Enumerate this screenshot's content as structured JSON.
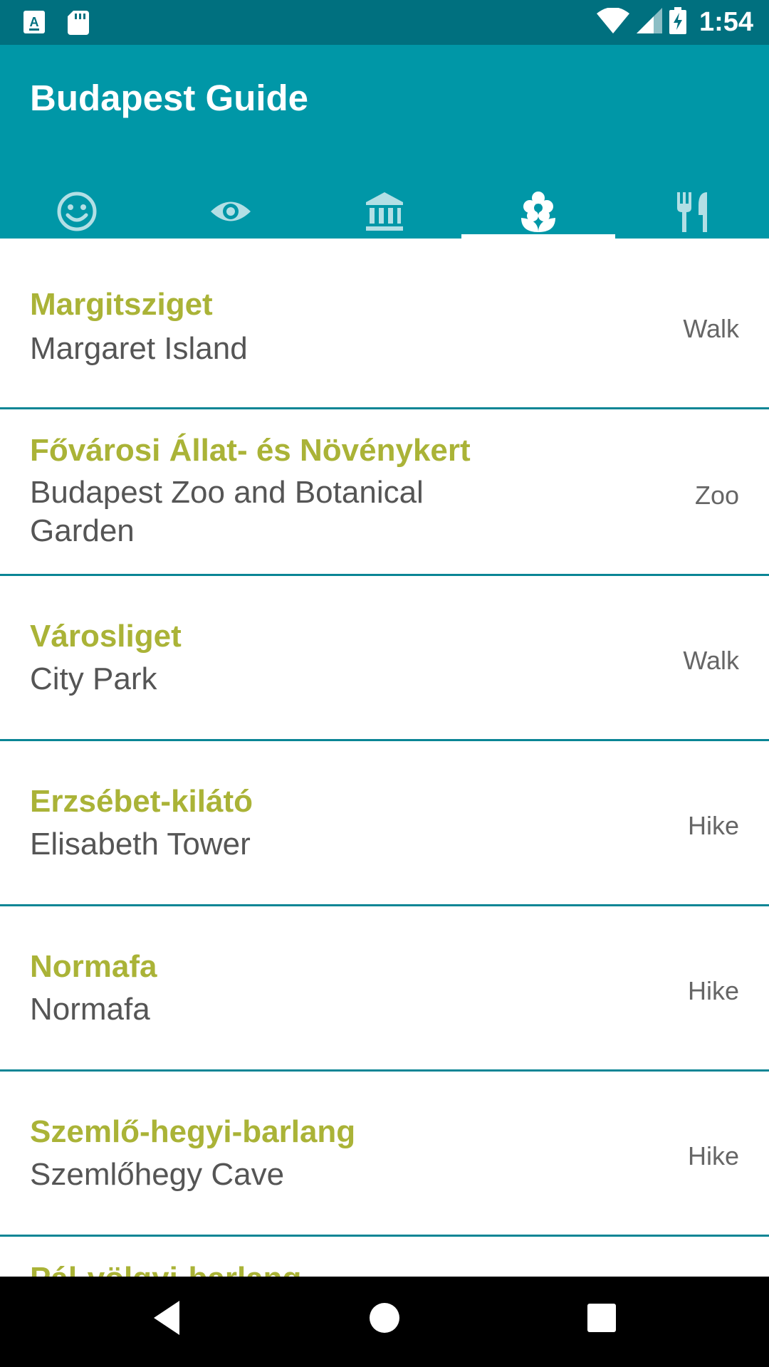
{
  "status_bar": {
    "time": "1:54",
    "left_icons": [
      "keyboard-a-icon",
      "sd-card-icon"
    ],
    "right_icons": [
      "wifi-icon",
      "signal-icon",
      "battery-charging-icon"
    ]
  },
  "app_bar": {
    "title": "Budapest Guide",
    "tabs": [
      {
        "icon": "smiley-icon",
        "selected": false
      },
      {
        "icon": "eye-icon",
        "selected": false
      },
      {
        "icon": "museum-icon",
        "selected": false
      },
      {
        "icon": "flower-icon",
        "selected": true
      },
      {
        "icon": "restaurant-icon",
        "selected": false
      }
    ]
  },
  "places": [
    {
      "name_hu": "Margitsziget",
      "name_en": "Margaret Island",
      "type": "Walk"
    },
    {
      "name_hu": "Fővárosi Állat- és Növénykert",
      "name_en": "Budapest Zoo and Botanical Garden",
      "type": "Zoo"
    },
    {
      "name_hu": "Városliget",
      "name_en": "City Park",
      "type": "Walk"
    },
    {
      "name_hu": "Erzsébet-kilátó",
      "name_en": "Elisabeth Tower",
      "type": "Hike"
    },
    {
      "name_hu": "Normafa",
      "name_en": "Normafa",
      "type": "Hike"
    },
    {
      "name_hu": "Szemlő-hegyi-barlang",
      "name_en": "Szemlőhegy Cave",
      "type": "Hike"
    }
  ],
  "partial_item": {
    "name_hu": "Pál-völgyi-barlang"
  },
  "colors": {
    "status_bar": "#00707f",
    "app_bar": "#0097a7",
    "accent_text": "#aab337",
    "divider": "#0a8595"
  },
  "nav_bar": {
    "icons": [
      "back-icon",
      "home-icon",
      "recents-icon"
    ]
  }
}
